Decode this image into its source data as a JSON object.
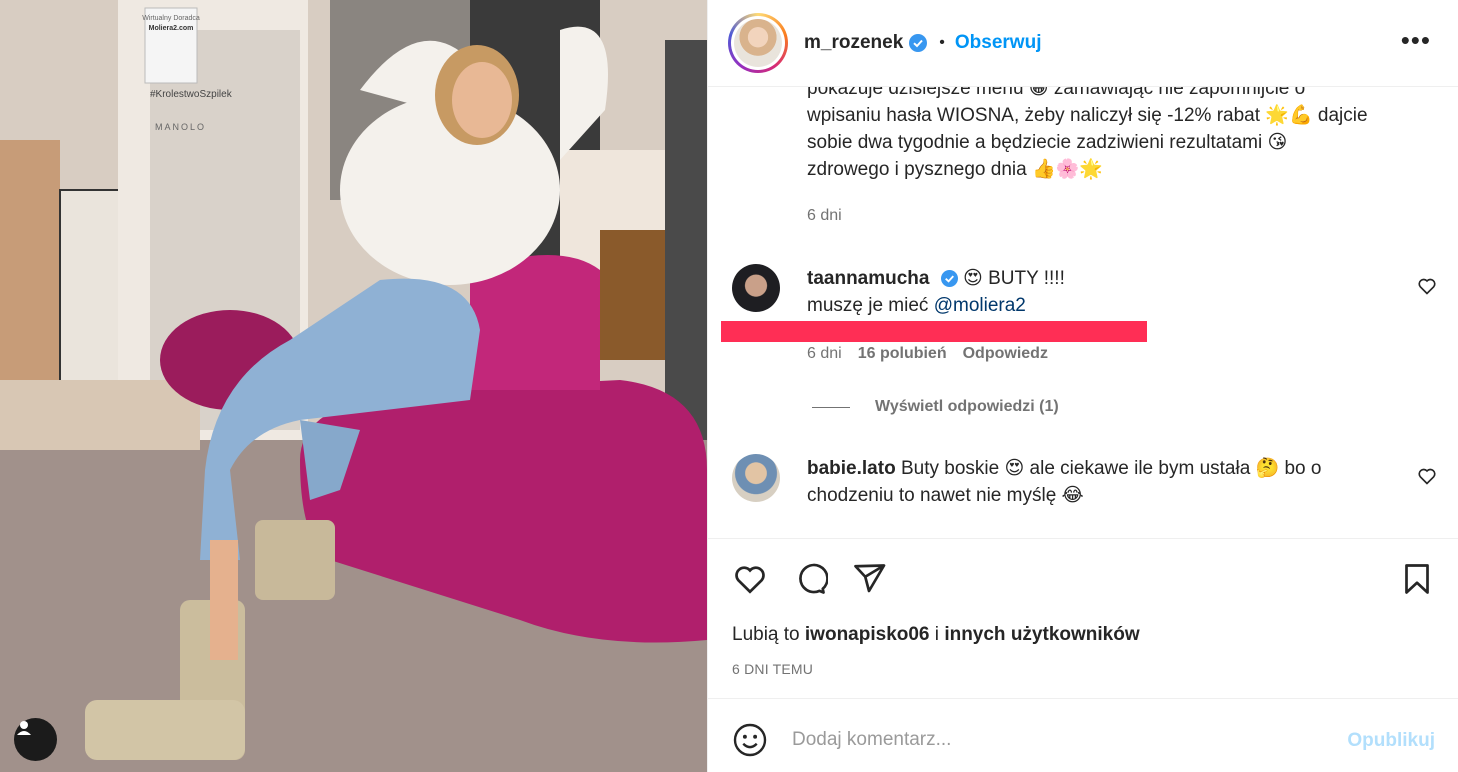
{
  "post": {
    "username": "m_rozenek",
    "verified": true,
    "separator": "•",
    "follow_label": "Obserwuj",
    "more_icon": "more-horizontal-icon",
    "more_label": "•••"
  },
  "caption": {
    "line1": "pokazuje dzisiejsze menu 😁 zamawiając nie zapomnijcie o",
    "line2": "wpisaniu hasła WIOSNA, żeby naliczył się -12% rabat 🌟💪 dajcie",
    "line3": "sobie dwa tygodnie a będziecie zadziwieni rezultatami 😘",
    "line4": "zdrowego i pysznego dnia 👍🌸🌟",
    "age": "6 dni"
  },
  "comments": [
    {
      "username": "taannamucha",
      "verified": true,
      "text_line1": "😍 BUTY !!!!",
      "text_line2_prefix": "muszę je mieć",
      "mention": "@moliera2",
      "age": "6 dni",
      "likes": "16 polubień",
      "reply_label": "Odpowiedz",
      "view_replies": "Wyświetl odpowiedzi (1)"
    },
    {
      "username": "babie.lato",
      "text_line1": "Buty boskie 😍 ale ciekawe ile bym ustała 🤔 bo o",
      "text_line2": "chodzeniu to nawet nie myślę 😂"
    }
  ],
  "actions": {
    "like_icon": "heart-icon",
    "comment_icon": "comment-icon",
    "share_icon": "send-icon",
    "save_icon": "bookmark-icon"
  },
  "likes": {
    "prefix": "Lubią to",
    "user": "iwonapisko06",
    "joiner": "i",
    "others": "innych użytkowników"
  },
  "timestamp": "6 DNI TEMU",
  "add_comment": {
    "placeholder": "Dodaj komentarz...",
    "publish_label": "Opublikuj",
    "emoji_icon": "smiley-icon"
  },
  "photo": {
    "tag_icon": "user-tag-icon",
    "poster_line1": "Wirtualny Doradca",
    "poster_line2": "Moliera2.com",
    "hashtag": "#KrolestwoSzpilek",
    "brand": "MANOLO"
  },
  "colors": {
    "accent": "#0095f6",
    "mention": "#00376b",
    "highlight_bar": "#ff2e55",
    "sofa": "#b01f6c"
  }
}
